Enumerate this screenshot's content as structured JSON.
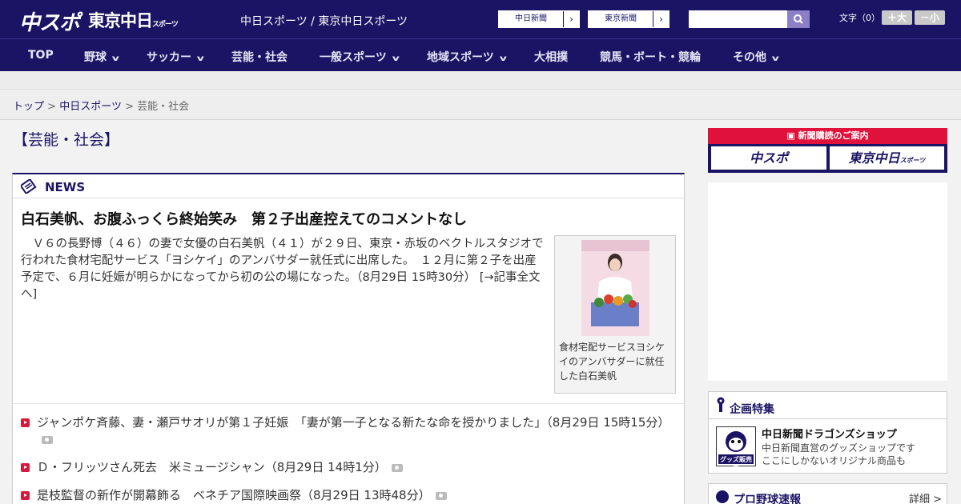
{
  "header": {
    "logo_chuspo": "中スポ",
    "logo_tokyo": "東京中日",
    "logo_tokyo_sub": "スポーツ",
    "site_title": "中日スポーツ / 東京中日スポーツ",
    "paper_links": [
      "中日新聞",
      "東京新聞"
    ],
    "search_placeholder": "",
    "font_label": "文字（0）",
    "font_plus": "＋大",
    "font_minus": "－小"
  },
  "nav": [
    {
      "label": "TOP",
      "chev": false
    },
    {
      "label": "野球",
      "chev": true
    },
    {
      "label": "サッカー",
      "chev": true
    },
    {
      "label": "芸能・社会",
      "chev": false
    },
    {
      "label": "一般スポーツ",
      "chev": true
    },
    {
      "label": "地域スポーツ",
      "chev": true
    },
    {
      "label": "大相撲",
      "chev": false
    },
    {
      "label": "競馬・ボート・競輪",
      "chev": false
    },
    {
      "label": "その他",
      "chev": true
    }
  ],
  "breadcrumb": {
    "home": "トップ",
    "site": "中日スポーツ",
    "current": "芸能・社会",
    "sep": ">"
  },
  "page_title": "【芸能・社会】",
  "news": {
    "section_label": "NEWS",
    "headline": "白石美帆、お腹ふっくら終始笑み　第２子出産控えてのコメントなし",
    "lead": "　Ｖ６の長野博（４６）の妻で女優の白石美帆（４１）が２９日、東京・赤坂のベクトルスタジオで行われた食材宅配サービス「ヨシケイ」のアンバサダー就任式に出席した。　１２月に第２子を出産予定で、６月に妊娠が明らかになってから初の公の場になった。（8月29日 15時30分）",
    "more": "[→記事全文へ]",
    "caption": "食材宅配サービスヨシケイのアンバサダーに就任した白石美帆",
    "items": [
      "ジャンポケ斉藤、妻・瀬戸サオリが第１子妊娠　「妻が第一子となる新たな命を授かりました」（8月29日 15時15分）",
      "Ｄ・フリッツさん死去　米ミュージシャン（8月29日 14時1分）",
      "是枝監督の新作が開幕飾る　ベネチア国際映画祭（8月29日 13時48分）"
    ]
  },
  "sidebar": {
    "subscribe_head": "新聞購読のご案内",
    "subscribe_buttons": [
      "中スポ",
      "東京中日"
    ],
    "subscribe_tokyo_sub": "スポーツ",
    "feature_head": "企画特集",
    "shop_title": "中日新聞ドラゴンズショップ",
    "shop_desc1": "中日新聞直営のグッズショップです",
    "shop_desc2": "ここにしかないオリジナル商品も",
    "shop_badge": "グッズ販売中",
    "baseball_head": "プロ野球速報",
    "baseball_more": "詳細 >"
  },
  "colors": {
    "brand": "#1b1464",
    "accent": "#e0113a"
  }
}
